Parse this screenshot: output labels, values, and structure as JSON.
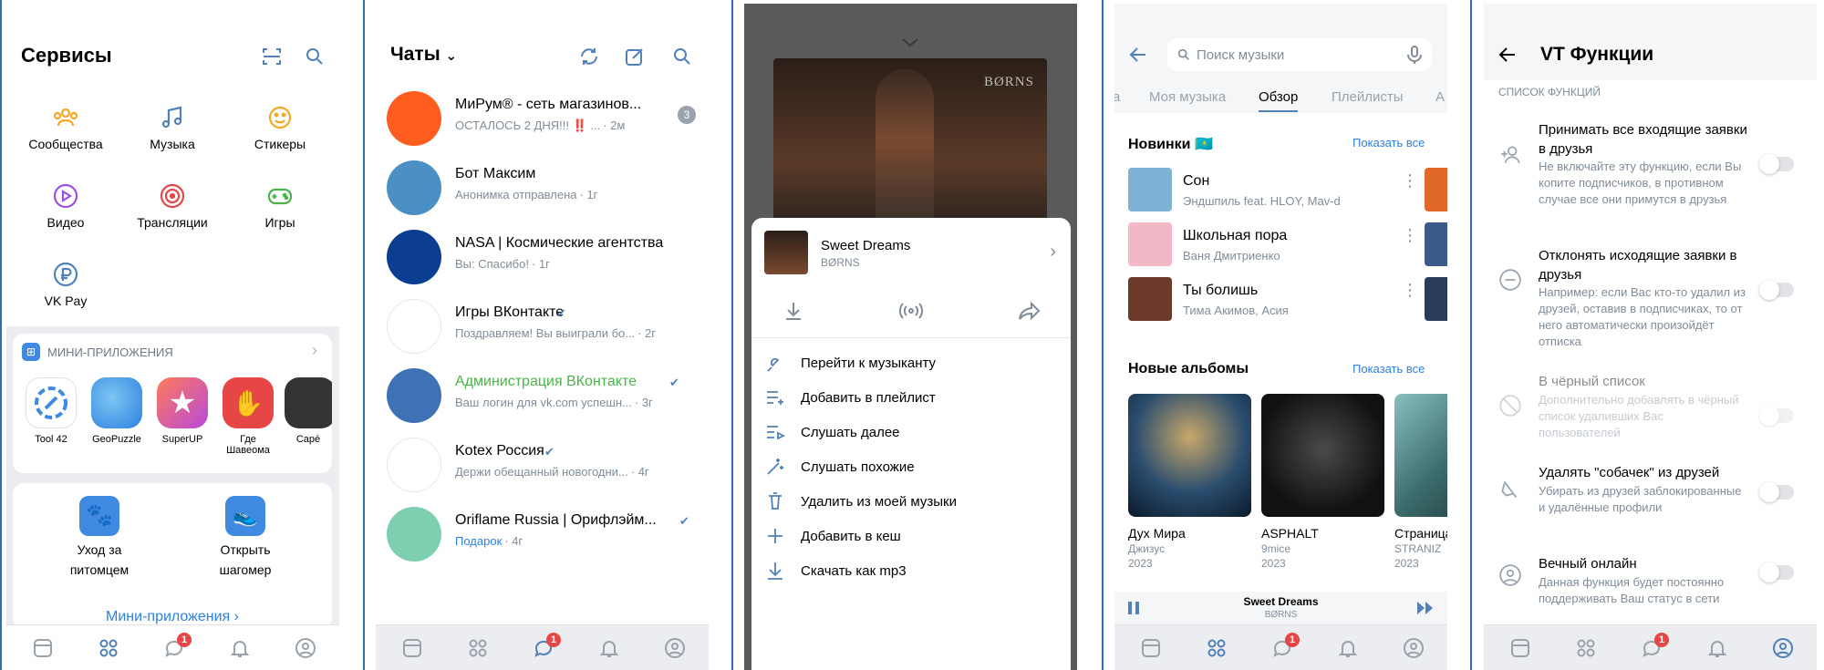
{
  "tabbar": {
    "messages_badge": "1"
  },
  "services": {
    "title": "Сервисы",
    "items": [
      {
        "label": "Сообщества",
        "icon": "communities-icon"
      },
      {
        "label": "Музыка",
        "icon": "music-icon"
      },
      {
        "label": "Стикеры",
        "icon": "stickers-icon"
      },
      {
        "label": "Видео",
        "icon": "video-icon"
      },
      {
        "label": "Трансляции",
        "icon": "broadcast-icon"
      },
      {
        "label": "Игры",
        "icon": "games-icon"
      },
      {
        "label": "VK Pay",
        "icon": "vkpay-icon"
      }
    ],
    "mini_apps": {
      "header": "МИНИ-ПРИЛОЖЕНИЯ",
      "apps": [
        {
          "label": "Tool 42",
          "color": "#3f8ae0"
        },
        {
          "label": "GeoPuzzle",
          "color": "#45a8e6"
        },
        {
          "label": "SuperUP",
          "color": "#b84ad9"
        },
        {
          "label": "Где Шавеома",
          "color": "#e64646"
        },
        {
          "label": "Capé",
          "color": "#333333"
        }
      ]
    },
    "featured": [
      {
        "label": "Уход за питомцем"
      },
      {
        "label": "Открыть шагомер"
      }
    ],
    "all_mini_apps": "Мини-приложения ›"
  },
  "chats": {
    "title": "Чаты",
    "items": [
      {
        "name": "МиРум® - сеть магазинов...",
        "message": "ОСТАЛОСЬ 2 ДНЯ!!! ‼️ ...",
        "time": "· 2м",
        "badge": "3",
        "color": "#ff5d1f"
      },
      {
        "name": "Бот Максим",
        "message": "Анонимка отправлена",
        "time": "· 1г",
        "color": "#4a90c4"
      },
      {
        "name": "NASA | Космические агентства",
        "message": "Вы: Спасибо!",
        "time": "· 1г",
        "color": "#0b3d91"
      },
      {
        "name": "Игры ВКонтакте",
        "message": "Поздравляем! Вы выиграли бо...",
        "time": "· 2г",
        "color": "#ffffff"
      },
      {
        "name": "Администрация ВКонтакте",
        "message": "Ваш логин для vk.com успешн...",
        "time": "· 3г",
        "color": "#3f71b5"
      },
      {
        "name": "Kotex Россия",
        "message": "Держи обещанный новогодни...",
        "time": "· 4г",
        "color": "#ffffff"
      },
      {
        "name": "Oriflame Russia | Орифлэйм...",
        "message": "Подарок",
        "time": "· 4г",
        "color": "#7ecfb0"
      }
    ]
  },
  "player": {
    "track": "Sweet Dreams",
    "artist": "BØRNS",
    "cover_text": "BØRNS",
    "menu": [
      {
        "label": "Перейти к музыканту",
        "icon": "artist-icon"
      },
      {
        "label": "Добавить в плейлист",
        "icon": "add-playlist-icon"
      },
      {
        "label": "Слушать далее",
        "icon": "play-next-icon"
      },
      {
        "label": "Слушать похожие",
        "icon": "similar-icon"
      },
      {
        "label": "Удалить из моей музыки",
        "icon": "delete-icon"
      },
      {
        "label": "Добавить в кеш",
        "icon": "plus-icon"
      },
      {
        "label": "Скачать как mp3",
        "icon": "download-icon"
      }
    ]
  },
  "music": {
    "search_placeholder": "Поиск музыки",
    "tabs": [
      "Моя музыка",
      "Обзор",
      "Плейлисты",
      "А"
    ],
    "active_tab": "Обзор",
    "new_section": "Новинки 🇰🇿",
    "show_all": "Показать все",
    "tracks": [
      {
        "title": "Сон",
        "artist": "Эндшпиль feat. HLOY, Mav-d",
        "color": "#7fb3d5"
      },
      {
        "title": "Школьная пора",
        "artist": "Ваня Дмитриенко",
        "color": "#f2b8c6"
      },
      {
        "title": "Ты болишь",
        "artist": "Тима Акимов, Асия",
        "color": "#6b3a2a"
      }
    ],
    "albums_section": "Новые альбомы",
    "albums": [
      {
        "title": "Дух Мира",
        "artist": "Джизус",
        "year": "2023",
        "color": "#2a4d6e"
      },
      {
        "title": "ASPHALT",
        "artist": "9mice",
        "year": "2023",
        "color": "#1a1a1a"
      },
      {
        "title": "Страница",
        "artist": "STRANIZ",
        "year": "2023",
        "color": "#3a6b6b"
      }
    ],
    "mini_player": {
      "track": "Sweet Dreams",
      "artist": "BØRNS"
    }
  },
  "vt": {
    "title": "VT Функции",
    "section": "СПИСОК ФУНКЦИЙ",
    "options": [
      {
        "title": "Принимать все входящие заявки в друзья",
        "desc": "Не включайте эту функцию, если Вы копите подписчиков, в противном случае все они примутся в друзья",
        "icon": "add-friend-icon"
      },
      {
        "title": "Отклонять исходящие заявки в друзья",
        "desc": "Например: если Вас кто-то удалил из друзей, оставив в подписчиках, то от него автоматически произойдёт отписка",
        "icon": "minus-circle-icon"
      },
      {
        "title": "В чёрный список",
        "desc": "Дополнительно добавлять в чёрный список удаливших Вас пользователей",
        "icon": "block-icon"
      },
      {
        "title": "Удалять \"собачек\" из друзей",
        "desc": "Убирать из друзей заблокированные и удалённые профили",
        "icon": "dog-icon"
      },
      {
        "title": "Вечный онлайн",
        "desc": "Данная функция будет постоянно поддерживать Ваш статус в сети",
        "icon": "online-icon"
      }
    ]
  }
}
